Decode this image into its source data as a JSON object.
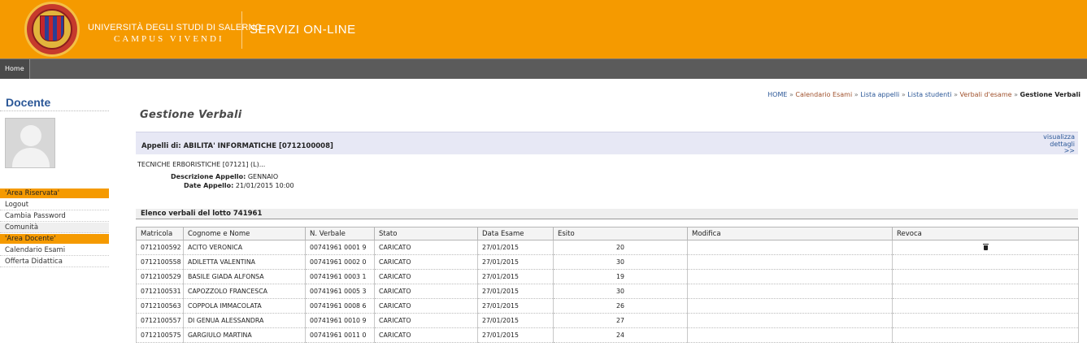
{
  "header": {
    "university_name": "UNIVERSITÀ DEGLI STUDI DI SALERNO",
    "motto": "CAMPUS VIVENDI",
    "service_title": "SERVIZI ON-LINE"
  },
  "nav": {
    "home_label": "Home"
  },
  "sidebar": {
    "title": "Docente",
    "sections": {
      "area_riservata": "'Area Riservata'",
      "logout": "Logout",
      "cambia_password": "Cambia Password",
      "comunita": "Comunità",
      "area_docente": "'Area Docente'",
      "calendario": "Calendario Esami",
      "offerta": "Offerta Didattica"
    }
  },
  "breadcrumb": {
    "home": "HOME",
    "separator": "»",
    "calendario": "Calendario Esami",
    "lista_appelli": "Lista appelli",
    "lista_studenti": "Lista studenti",
    "verbali": "Verbali d'esame",
    "current": "Gestione Verbali"
  },
  "page": {
    "title": "Gestione Verbali",
    "appelli_label": "Appelli di: ABILITA' INFORMATICHE [0712100008]",
    "visualizza_1": "visualizza",
    "visualizza_2": "dettagli",
    "visualizza_3": ">>",
    "corso": "TECNICHE ERBORISTICHE [07121] (L)...",
    "descrizione_label": "Descrizione Appello:",
    "descrizione_value": "GENNAIO",
    "date_label": "Date Appello:",
    "date_value": "21/01/2015 10:00",
    "list_title": "Elenco verbali del lotto 741961"
  },
  "table": {
    "headers": {
      "matricola": "Matricola",
      "nome": "Cognome e Nome",
      "verbale": "N. Verbale",
      "stato": "Stato",
      "data": "Data Esame",
      "esito": "Esito",
      "modifica": "Modifica",
      "revoca": "Revoca"
    },
    "rows": [
      {
        "matricola": "0712100592",
        "nome": "ACITO VERONICA",
        "verbale": "00741961 0001 9",
        "stato": "CARICATO",
        "data": "27/01/2015",
        "esito": "20"
      },
      {
        "matricola": "0712100558",
        "nome": "ADILETTA VALENTINA",
        "verbale": "00741961 0002 0",
        "stato": "CARICATO",
        "data": "27/01/2015",
        "esito": "30"
      },
      {
        "matricola": "0712100529",
        "nome": "BASILE GIADA ALFONSA",
        "verbale": "00741961 0003 1",
        "stato": "CARICATO",
        "data": "27/01/2015",
        "esito": "19"
      },
      {
        "matricola": "0712100531",
        "nome": "CAPOZZOLO FRANCESCA",
        "verbale": "00741961 0005 3",
        "stato": "CARICATO",
        "data": "27/01/2015",
        "esito": "30"
      },
      {
        "matricola": "0712100563",
        "nome": "COPPOLA IMMACOLATA",
        "verbale": "00741961 0008 6",
        "stato": "CARICATO",
        "data": "27/01/2015",
        "esito": "26"
      },
      {
        "matricola": "0712100557",
        "nome": "DI GENUA ALESSANDRA",
        "verbale": "00741961 0010 9",
        "stato": "CARICATO",
        "data": "27/01/2015",
        "esito": "27"
      },
      {
        "matricola": "0712100575",
        "nome": "GARGIULO MARTINA",
        "verbale": "00741961 0011 0",
        "stato": "CARICATO",
        "data": "27/01/2015",
        "esito": "24"
      }
    ]
  },
  "icons": {
    "revoca_row0": "trash-icon",
    "logo": "university-seal-logo",
    "avatar": "user-avatar-icon"
  },
  "colors": {
    "brand_orange": "#f59a00",
    "nav_gray": "#5b5b5b",
    "link_blue": "#2b5797",
    "panel_lavender": "#e7e8f5"
  }
}
